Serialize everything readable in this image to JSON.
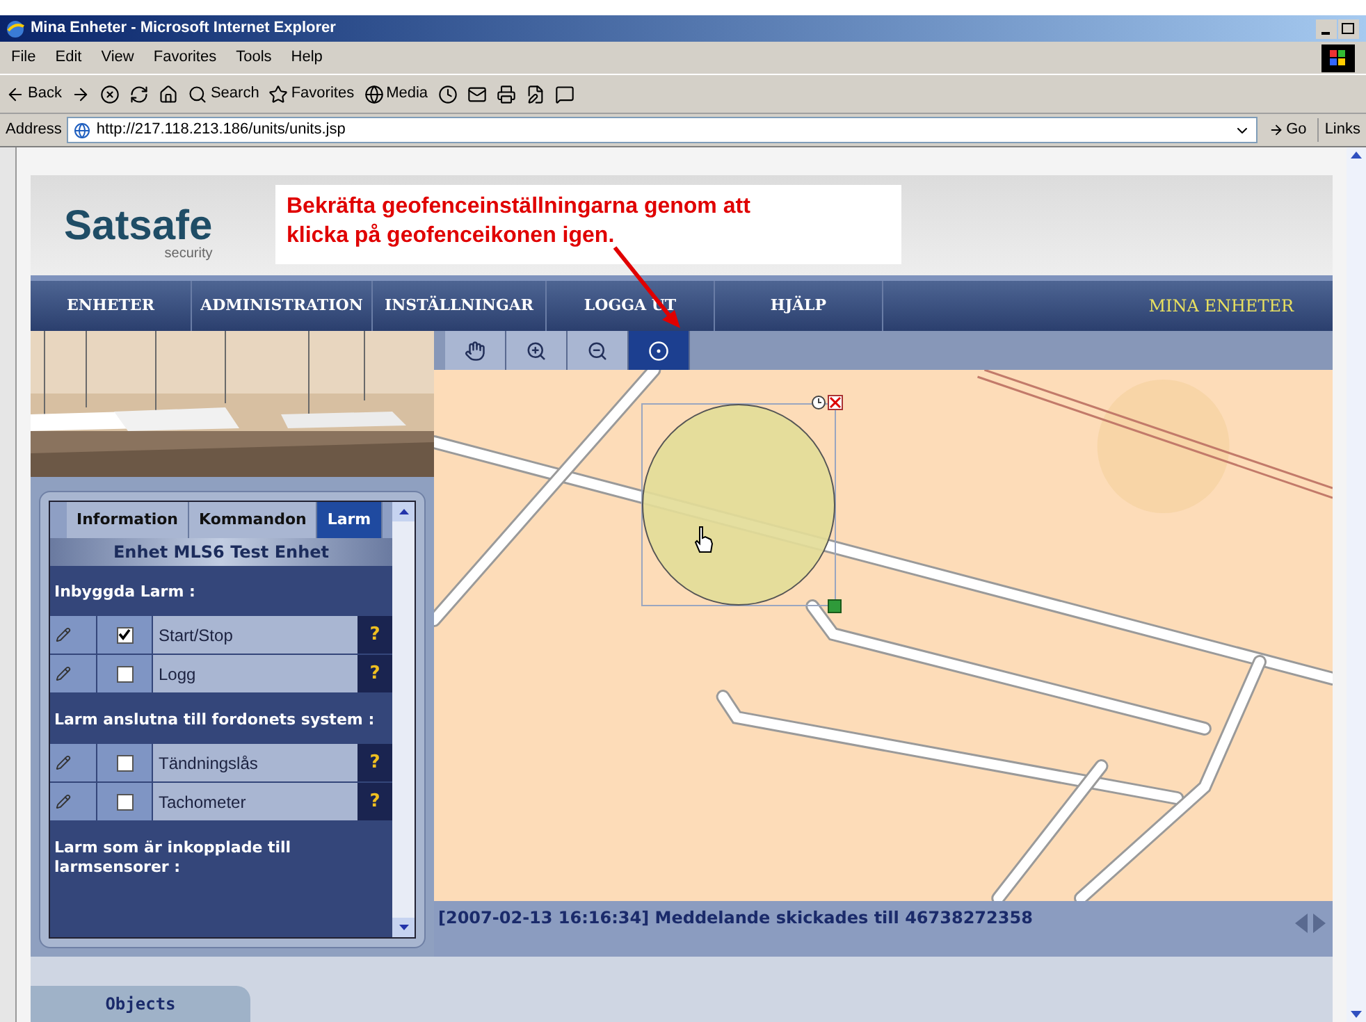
{
  "window": {
    "title": "Mina Enheter - Microsoft Internet Explorer"
  },
  "menu_bar": [
    "File",
    "Edit",
    "View",
    "Favorites",
    "Tools",
    "Help"
  ],
  "toolbar": [
    {
      "kind": "back",
      "label": "Back"
    },
    {
      "kind": "forward"
    },
    {
      "kind": "stop"
    },
    {
      "kind": "refresh"
    },
    {
      "kind": "home"
    },
    {
      "kind": "search",
      "label": "Search"
    },
    {
      "kind": "favorites",
      "label": "Favorites"
    },
    {
      "kind": "media",
      "label": "Media"
    },
    {
      "kind": "history"
    },
    {
      "kind": "mail"
    },
    {
      "kind": "print"
    },
    {
      "kind": "edit"
    },
    {
      "kind": "discuss"
    }
  ],
  "address_bar": {
    "label": "Address",
    "url": "http://217.118.213.186/units/units.jsp",
    "go": "Go",
    "links": "Links"
  },
  "logo": {
    "name": "Satsafe",
    "tagline": "security"
  },
  "callout": "Bekräfta geofenceinställningarna genom att klicka på geofenceikonen igen.",
  "nav": [
    "ENHETER",
    "ADMINISTRATION",
    "INSTÄLLNINGAR",
    "LOGGA UT",
    "HJÄLP"
  ],
  "nav_title": "MINA ENHETER",
  "map_tools": [
    {
      "kind": "pan",
      "selected": false
    },
    {
      "kind": "zoom-in",
      "selected": false
    },
    {
      "kind": "zoom-out",
      "selected": false
    },
    {
      "kind": "geofence",
      "selected": true
    }
  ],
  "panel": {
    "tabs": [
      {
        "label": "Information",
        "selected": false
      },
      {
        "label": "Kommandon",
        "selected": false
      },
      {
        "label": "Larm",
        "selected": true
      }
    ],
    "unit": "Enhet MLS6 Test Enhet",
    "sections": [
      {
        "heading": "Inbyggda Larm :",
        "alarms": [
          {
            "name": "Start/Stop",
            "checked": true,
            "help": "?"
          },
          {
            "name": "Logg",
            "checked": false,
            "help": "?"
          }
        ]
      },
      {
        "heading": "Larm anslutna till fordonets system :",
        "alarms": [
          {
            "name": "Tändningslås",
            "checked": false,
            "help": "?"
          },
          {
            "name": "Tachometer",
            "checked": false,
            "help": "?"
          }
        ]
      },
      {
        "heading": "Larm som är inkopplade till larmsensorer :"
      }
    ]
  },
  "status_message": "[2007-02-13 16:16:34] Meddelande skickades till 46738272358",
  "bottom_tabs": [
    {
      "label": "Objects",
      "selected": true
    }
  ]
}
